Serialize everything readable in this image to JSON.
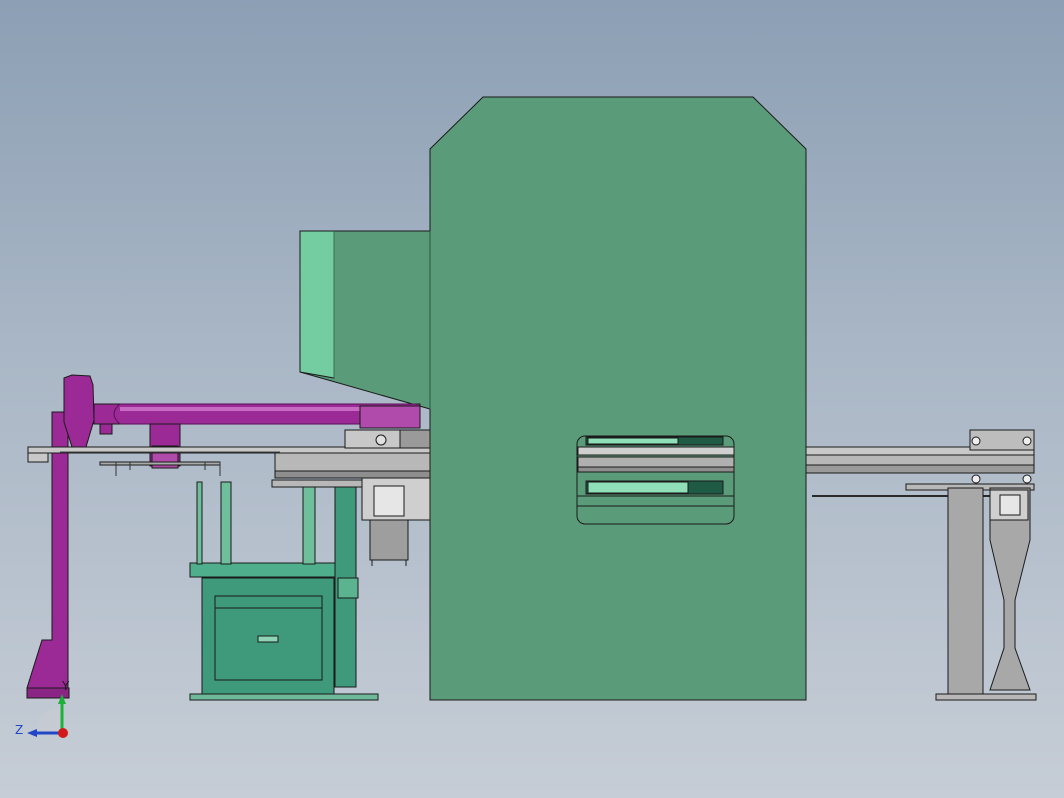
{
  "view": {
    "background_top": "#8c9fb4",
    "background_bottom": "#c6cdd6"
  },
  "colors": {
    "press_body": "#5a9b79",
    "press_highlight": "#74cda0",
    "press_shadow": "#1f5a44",
    "robot_arm": "#9c2a96",
    "robot_arm_light": "#c76ac2",
    "conveyor": "#b4b4b4",
    "conveyor_dark": "#6e6e6e",
    "stacker_base": "#3f9a7b",
    "outline": "#1a1a1a"
  },
  "axis_triad": {
    "y_label": "Y",
    "z_label": "Z",
    "y_color": "#1db13a",
    "z_color": "#2246c8",
    "x_dot_color": "#d21a1a"
  }
}
